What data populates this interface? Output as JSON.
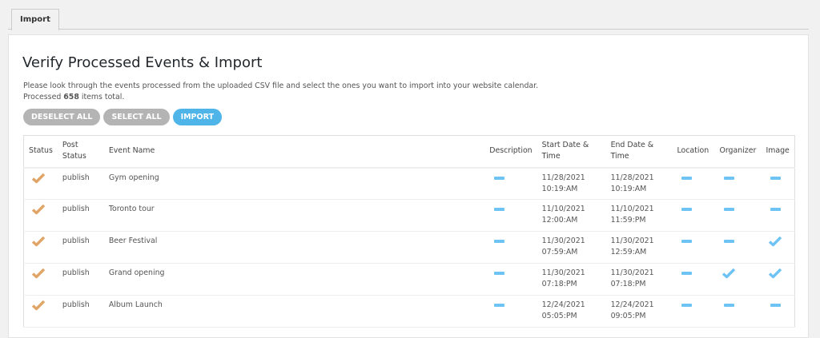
{
  "tabs": [
    {
      "label": "Import"
    }
  ],
  "title": "Verify Processed Events & Import",
  "description": "Please look through the events processed from the uploaded CSV file and select the ones you want to import into your website calendar.",
  "processed": {
    "prefix": "Processed",
    "count": "658",
    "suffix": "items total."
  },
  "buttons": {
    "deselect_all": "DESELECT ALL",
    "select_all": "SELECT ALL",
    "import": "IMPORT"
  },
  "colors": {
    "accent": "#4fb4e8",
    "status_check": "#e0a566",
    "field_icon": "#6ec3f5"
  },
  "columns": [
    "Status",
    "Post Status",
    "Event Name",
    "Description",
    "Start Date & Time",
    "End Date & Time",
    "Location",
    "Organizer",
    "Image"
  ],
  "rows": [
    {
      "status": "check",
      "post_status": "publish",
      "name": "Gym opening",
      "description": "dash",
      "start_date": "11/28/2021",
      "start_time": "10:19:AM",
      "end_date": "11/28/2021",
      "end_time": "10:19:AM",
      "location": "dash",
      "organizer": "dash",
      "image": "dash"
    },
    {
      "status": "check",
      "post_status": "publish",
      "name": "Toronto tour",
      "description": "dash",
      "start_date": "11/10/2021",
      "start_time": "12:00:AM",
      "end_date": "11/10/2021",
      "end_time": "11:59:PM",
      "location": "dash",
      "organizer": "dash",
      "image": "dash"
    },
    {
      "status": "check",
      "post_status": "publish",
      "name": "Beer Festival",
      "description": "dash",
      "start_date": "11/30/2021",
      "start_time": "07:59:AM",
      "end_date": "11/30/2021",
      "end_time": "12:59:AM",
      "location": "dash",
      "organizer": "dash",
      "image": "check"
    },
    {
      "status": "check",
      "post_status": "publish",
      "name": "Grand opening",
      "description": "dash",
      "start_date": "11/30/2021",
      "start_time": "07:18:PM",
      "end_date": "11/30/2021",
      "end_time": "07:18:PM",
      "location": "dash",
      "organizer": "check",
      "image": "check"
    },
    {
      "status": "check",
      "post_status": "publish",
      "name": "Album Launch",
      "description": "dash",
      "start_date": "12/24/2021",
      "start_time": "05:05:PM",
      "end_date": "12/24/2021",
      "end_time": "09:05:PM",
      "location": "dash",
      "organizer": "dash",
      "image": "dash"
    }
  ]
}
